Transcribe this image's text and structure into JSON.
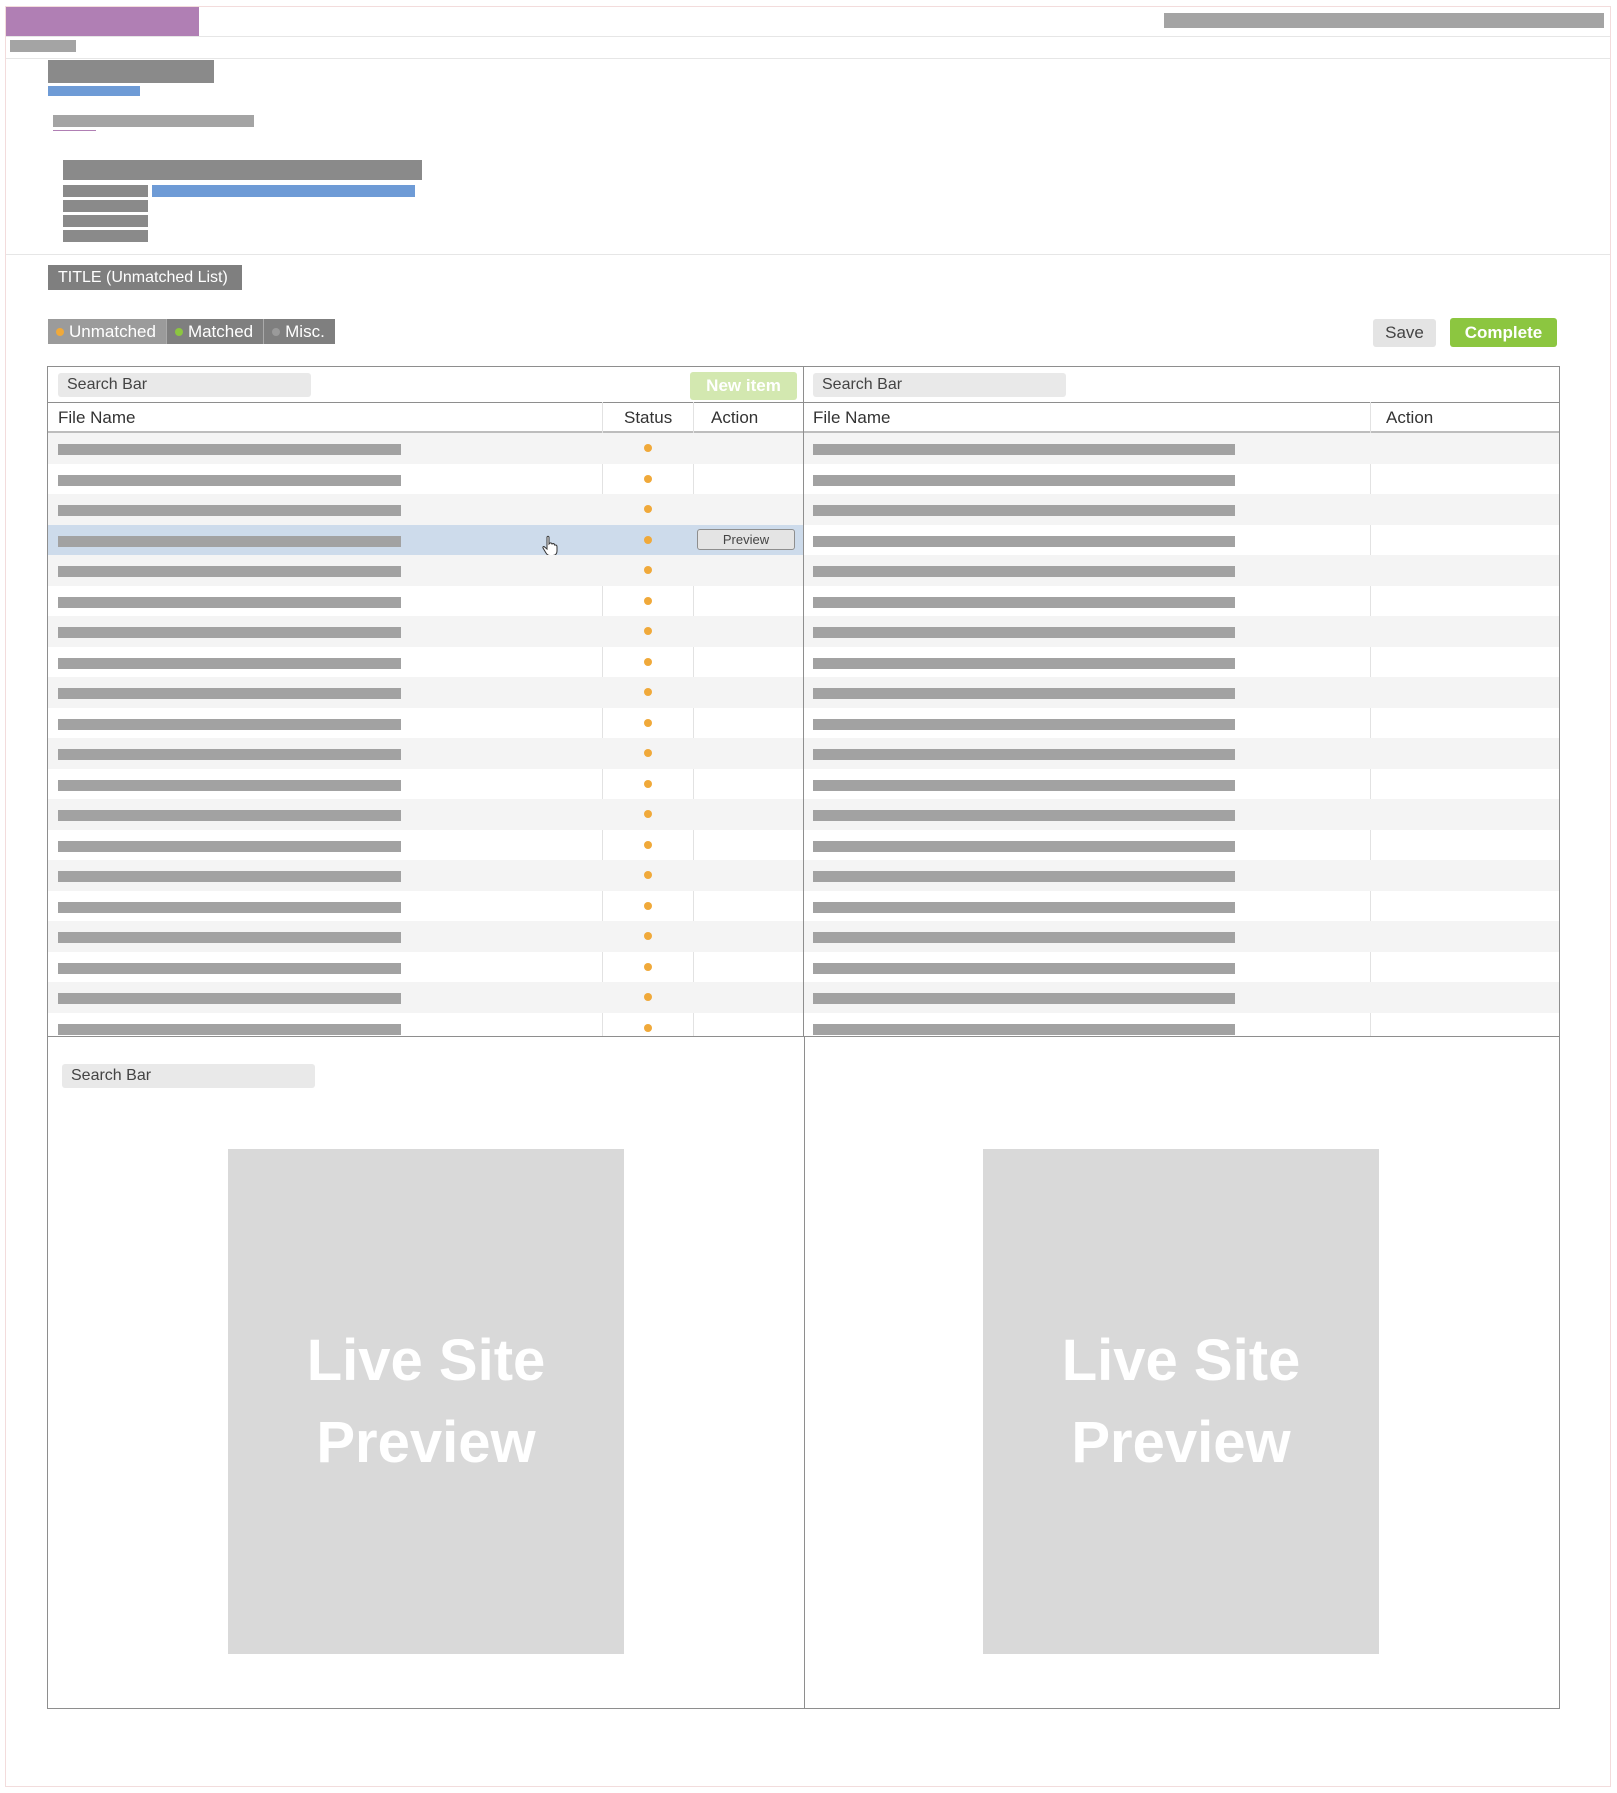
{
  "title_badge": "TITLE (Unmatched List)",
  "tabs": [
    {
      "label": "Unmatched",
      "dot_color": "#f0a93a",
      "active": true
    },
    {
      "label": "Matched",
      "dot_color": "#8cc640",
      "active": false
    },
    {
      "label": "Misc.",
      "dot_color": "#9a9a9a",
      "active": false
    }
  ],
  "actions": {
    "save_label": "Save",
    "complete_label": "Complete"
  },
  "left_panel": {
    "search_placeholder": "Search Bar",
    "new_item_label": "New item",
    "columns": [
      "File Name",
      "Status",
      "Action"
    ],
    "row_count": 20,
    "selected_row": 3,
    "preview_button_label": "Preview"
  },
  "right_panel": {
    "search_placeholder": "Search Bar",
    "columns": [
      "File Name",
      "Action"
    ],
    "row_count": 20
  },
  "preview_panel": {
    "search_placeholder": "Search Bar",
    "left_preview": {
      "line1": "Live Site",
      "line2": "Preview"
    },
    "right_preview": {
      "line1": "Live Site",
      "line2": "Preview"
    }
  },
  "colors": {
    "brand": "#b07fb4",
    "accent_green": "#8cc640",
    "status_unmatched": "#f0a93a",
    "selected_row": "#cddbeb"
  }
}
